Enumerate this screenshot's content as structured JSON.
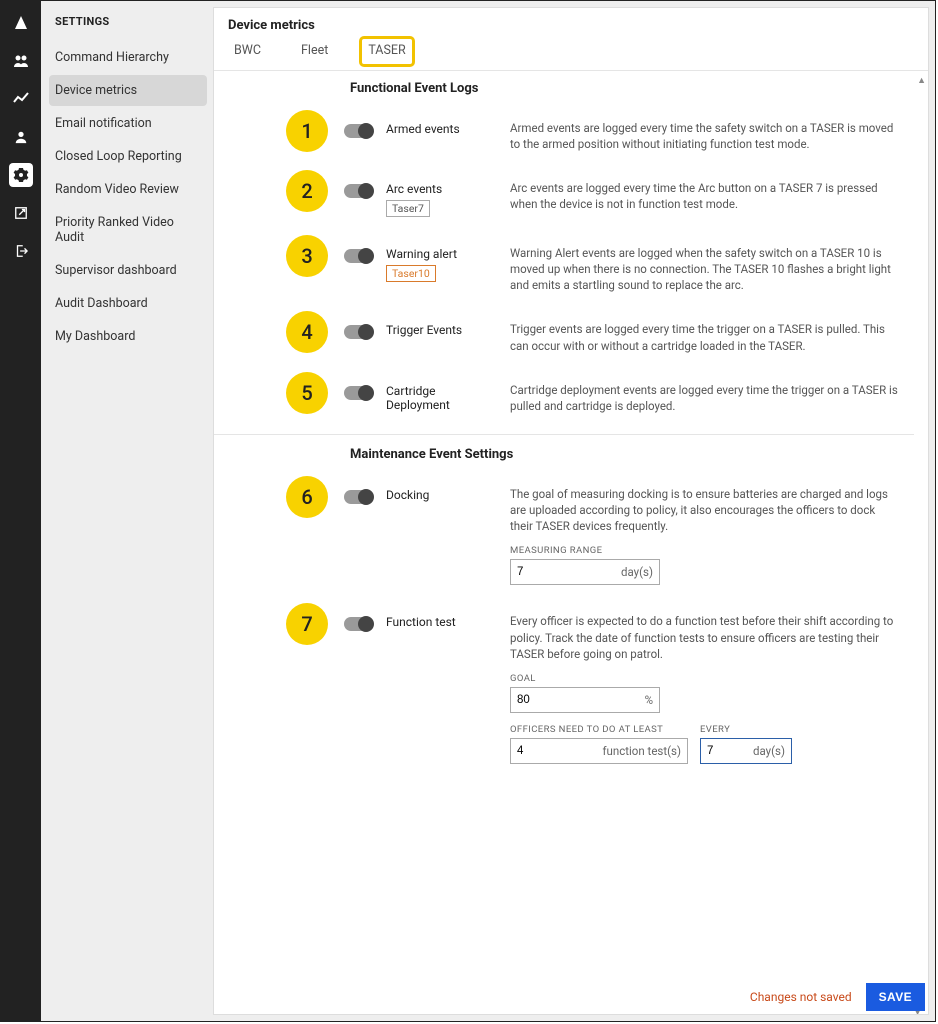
{
  "sidebar": {
    "title": "SETTINGS",
    "items": [
      {
        "label": "Command Hierarchy"
      },
      {
        "label": "Device metrics"
      },
      {
        "label": "Email notification"
      },
      {
        "label": "Closed Loop Reporting"
      },
      {
        "label": "Random Video Review"
      },
      {
        "label": "Priority Ranked Video Audit"
      },
      {
        "label": "Supervisor dashboard"
      },
      {
        "label": "Audit Dashboard"
      },
      {
        "label": "My Dashboard"
      }
    ],
    "selected_index": 1
  },
  "panel": {
    "title": "Device metrics",
    "tabs": [
      "BWC",
      "Fleet",
      "TASER"
    ],
    "active_tab": 2
  },
  "sections": {
    "functional": {
      "heading": "Functional Event Logs",
      "rows": [
        {
          "num": "1",
          "label": "Armed events",
          "desc": "Armed events are logged every time the safety switch on a TASER is moved to the armed position without initiating function test mode."
        },
        {
          "num": "2",
          "label": "Arc events",
          "chip": "Taser7",
          "chip_style": "plain",
          "desc": "Arc events are logged every time the Arc button on a TASER 7 is pressed when the device is not in function test mode."
        },
        {
          "num": "3",
          "label": "Warning alert",
          "chip": "Taser10",
          "chip_style": "orange",
          "desc": "Warning Alert events are logged when the safety switch on a TASER 10 is moved up when there is no connection. The TASER 10 flashes a bright light and emits a startling sound to replace the arc."
        },
        {
          "num": "4",
          "label": "Trigger Events",
          "desc": "Trigger events are logged every time the trigger on a TASER is pulled. This can occur with or without a cartridge loaded in the TASER."
        },
        {
          "num": "5",
          "label": "Cartridge Deployment",
          "desc": "Cartridge deployment events are logged every time the trigger on a TASER is pulled and cartridge is deployed."
        }
      ]
    },
    "maintenance": {
      "heading": "Maintenance Event Settings",
      "docking": {
        "num": "6",
        "label": "Docking",
        "desc": "The goal of measuring docking is to ensure batteries are charged and logs are uploaded according to policy, it also encourages the officers to dock their TASER devices frequently.",
        "range_label": "MEASURING RANGE",
        "range_value": "7",
        "range_unit": "day(s)"
      },
      "function_test": {
        "num": "7",
        "label": "Function test",
        "desc": "Every officer is expected to do a function test before their shift according to policy. Track the date of function tests to ensure officers are testing their TASER before going on patrol.",
        "goal_label": "GOAL",
        "goal_value": "80",
        "goal_unit": "%",
        "atleast_label": "OFFICERS NEED TO DO AT LEAST",
        "atleast_value": "4",
        "atleast_unit": "function test(s)",
        "every_label": "EVERY",
        "every_value": "7",
        "every_unit": "day(s)"
      }
    }
  },
  "footer": {
    "unsaved": "Changes not saved",
    "save": "SAVE"
  }
}
